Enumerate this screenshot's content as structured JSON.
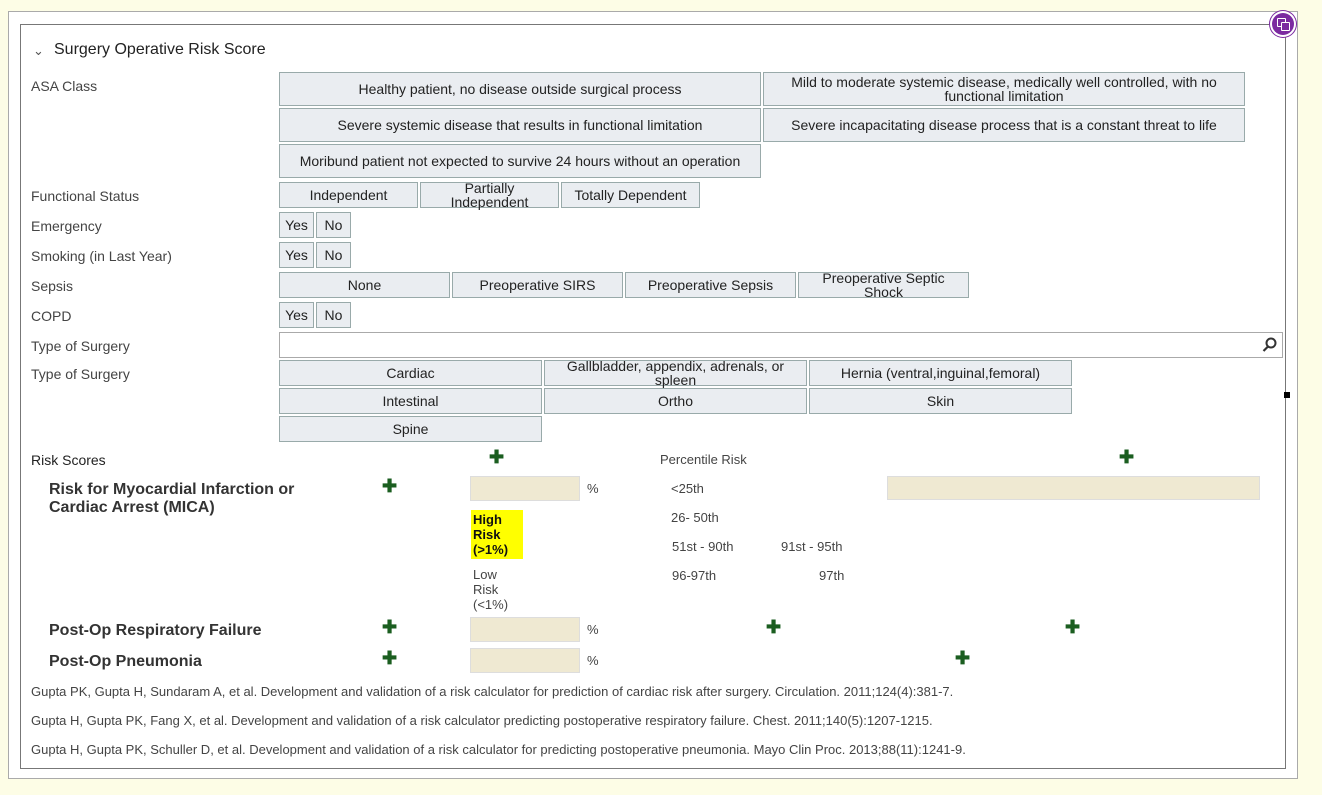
{
  "section": {
    "title": "Surgery Operative Risk Score",
    "collapse_icon": "chevron-down-icon"
  },
  "asa": {
    "label": "ASA Class",
    "options": [
      "Healthy patient, no disease outside surgical process",
      "Mild to moderate systemic disease, medically well controlled, with no functional limitation",
      "Severe systemic disease that results in functional limitation",
      "Severe incapacitating disease process that is a constant threat to life",
      "Moribund patient not expected to survive 24 hours without an operation"
    ]
  },
  "functional": {
    "label": "Functional Status",
    "options": [
      "Independent",
      "Partially Independent",
      "Totally Dependent"
    ]
  },
  "emergency": {
    "label": "Emergency",
    "options": [
      "Yes",
      "No"
    ]
  },
  "smoking": {
    "label": "Smoking (in Last Year)",
    "options": [
      "Yes",
      "No"
    ]
  },
  "sepsis": {
    "label": "Sepsis",
    "options": [
      "None",
      "Preoperative SIRS",
      "Preoperative Sepsis",
      "Preoperative Septic Shock"
    ]
  },
  "copd": {
    "label": "COPD",
    "options": [
      "Yes",
      "No"
    ]
  },
  "surgery_search": {
    "label": "Type of Surgery",
    "value": "",
    "icon": "search-icon"
  },
  "surgery_type": {
    "label": "Type of Surgery",
    "options": [
      "Cardiac",
      "Gallbladder, appendix, adrenals, or spleen",
      "Hernia (ventral,inguinal,femoral)",
      "Intestinal",
      "Ortho",
      "Skin",
      "Spine"
    ]
  },
  "risk": {
    "label": "Risk Scores",
    "percentile_label": "Percentile Risk",
    "mica": {
      "name": "Risk for Myocardial Infarction or Cardiac Arrest (MICA)",
      "unit": "%",
      "value": "",
      "high_risk": "High Risk (>1%)",
      "low_risk": "Low Risk (<1%)",
      "percentiles": [
        "<25th",
        "26- 50th",
        "51st - 90th",
        "91st - 95th",
        "96-97th",
        "97th"
      ]
    },
    "resp": {
      "name": "Post-Op Respiratory Failure",
      "unit": "%",
      "value": ""
    },
    "pneu": {
      "name": "Post-Op Pneumonia",
      "unit": "%",
      "value": ""
    }
  },
  "references": [
    "Gupta PK, Gupta H, Sundaram A, et al. Development and validation of a risk calculator for prediction of cardiac risk after surgery. Circulation. 2011;124(4):381-7.",
    "Gupta H, Gupta PK, Fang X, et al. Development and validation of a risk calculator predicting postoperative respiratory failure. Chest. 2011;140(5):1207-1215.",
    "Gupta H, Gupta PK, Schuller D, et al. Development and validation of a risk calculator for predicting postoperative pneumonia. Mayo Clin Proc. 2013;88(11):1241-9."
  ],
  "colors": {
    "highlight": "#ffff00",
    "plus": "#1b5e20",
    "badge": "#7b2aa0",
    "field_bg": "#efe9d2",
    "page_bg": "#fdfde6"
  }
}
